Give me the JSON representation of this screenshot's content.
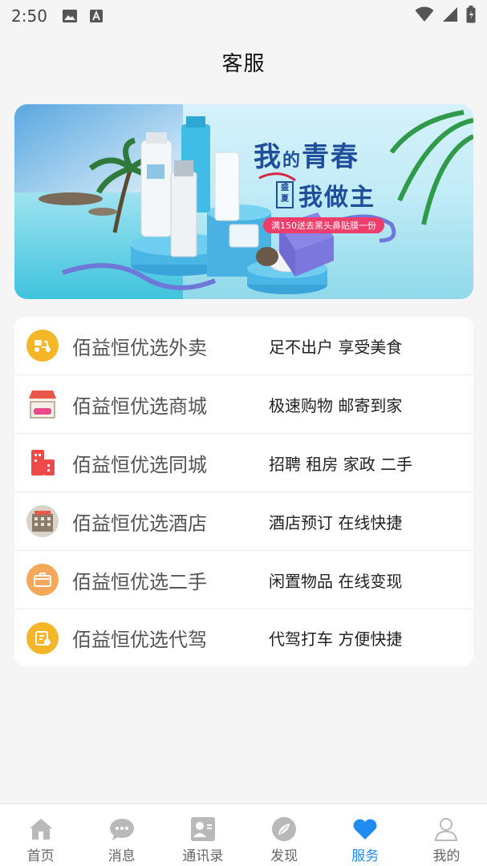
{
  "status_bar": {
    "time": "2:50"
  },
  "header": {
    "title": "客服"
  },
  "banner": {
    "line1_a": "我",
    "line1_b": "的",
    "line1_c": "青春",
    "stamp": "盛夏",
    "line2": "我做主",
    "promo": "满150送去黑头鼻贴膜一份"
  },
  "services": [
    {
      "name": "佰益恒优选外卖",
      "desc": "足不出户 享受美食",
      "icon": "scooter-icon",
      "color": "#f5b627"
    },
    {
      "name": "佰益恒优选商城",
      "desc": "极速购物 邮寄到家",
      "icon": "shop-icon",
      "color": "#e8574a"
    },
    {
      "name": "佰益恒优选同城",
      "desc": "招聘 租房 家政 二手",
      "icon": "city-buildings-icon",
      "color": "#ef4a4a"
    },
    {
      "name": "佰益恒优选酒店",
      "desc": "酒店预订 在线快捷",
      "icon": "hotel-icon",
      "color": "#8a7a6a"
    },
    {
      "name": "佰益恒优选二手",
      "desc": "闲置物品 在线变现",
      "icon": "box-icon",
      "color": "#f5a85a"
    },
    {
      "name": "佰益恒优选代驾",
      "desc": "代驾打车 方便快捷",
      "icon": "car-icon",
      "color": "#f5b627"
    }
  ],
  "tabs": [
    {
      "label": "首页",
      "icon": "home-icon"
    },
    {
      "label": "消息",
      "icon": "message-icon"
    },
    {
      "label": "通讯录",
      "icon": "contacts-icon"
    },
    {
      "label": "发现",
      "icon": "discover-icon"
    },
    {
      "label": "服务",
      "icon": "heart-icon",
      "active": true
    },
    {
      "label": "我的",
      "icon": "user-icon"
    }
  ],
  "colors": {
    "accent": "#1e8cf0",
    "inactive_tab": "#b9b9b9"
  }
}
